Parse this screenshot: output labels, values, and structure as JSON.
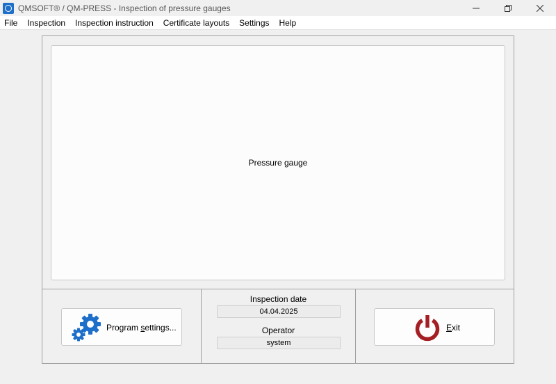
{
  "window": {
    "title": "QMSOFT® / QM-PRESS - Inspection of pressure gauges"
  },
  "menu": [
    {
      "label": "File"
    },
    {
      "label": "Inspection"
    },
    {
      "label": "Inspection instruction"
    },
    {
      "label": "Certificate layouts"
    },
    {
      "label": "Settings"
    },
    {
      "label": "Help"
    }
  ],
  "display": {
    "label": "Pressure gauge"
  },
  "buttons": {
    "settings_prefix": "Program ",
    "settings_mnemonic": "s",
    "settings_suffix": "ettings...",
    "exit_mnemonic": "E",
    "exit_suffix": "xit"
  },
  "inspection": {
    "date_label": "Inspection date",
    "date_value": "04.04.2025",
    "operator_label": "Operator",
    "operator_value": "system"
  },
  "colors": {
    "gear_blue": "#1e6fc9",
    "power_red": "#a31f24"
  }
}
